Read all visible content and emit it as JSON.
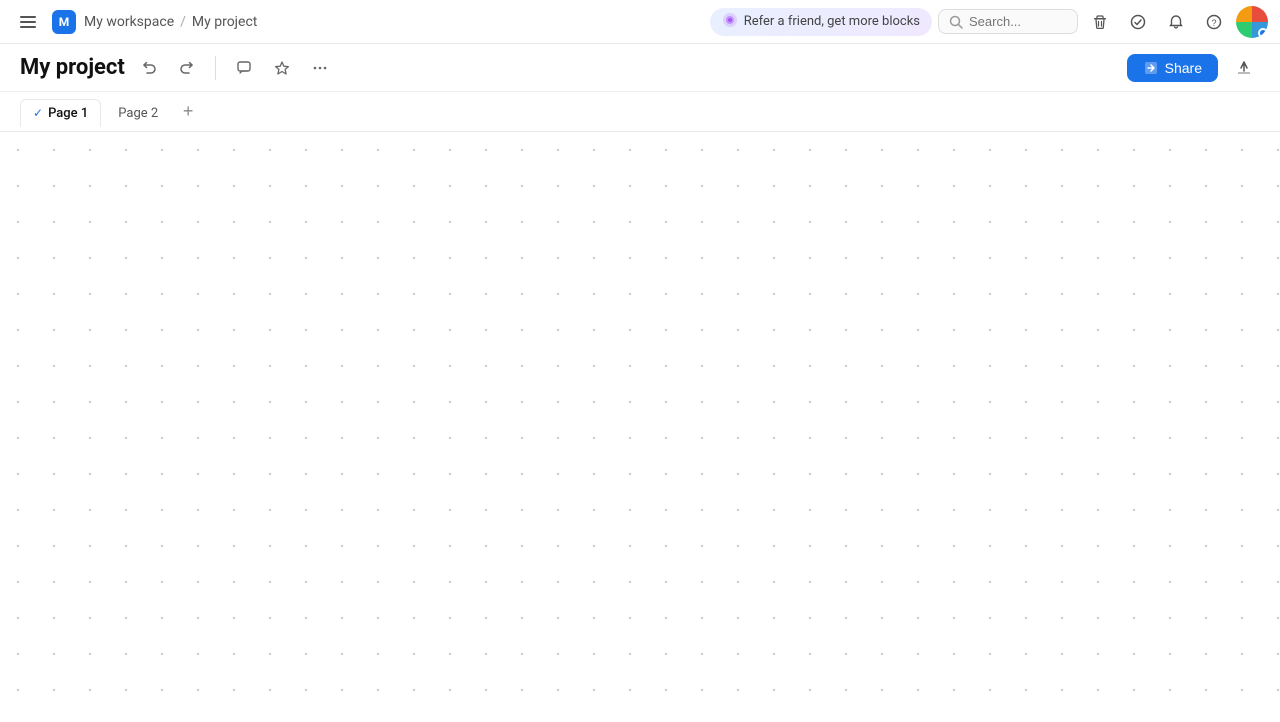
{
  "app": {
    "menu_icon": "☰",
    "workspace": {
      "avatar_letter": "M",
      "name": "My workspace"
    },
    "breadcrumb_sep": "/",
    "project": "My project"
  },
  "topnav": {
    "refer_icon": "🎁",
    "refer_label": "Refer a friend, get more blocks",
    "search_placeholder": "Search...",
    "search_icon": "🔍",
    "trash_icon": "🗑",
    "checkmark_icon": "✓",
    "bell_icon": "🔔",
    "help_icon": "?"
  },
  "toolbar": {
    "title": "My project",
    "undo_icon": "↺",
    "redo_icon": "↻",
    "comment_icon": "💬",
    "star_icon": "☆",
    "more_icon": "•••",
    "share_label": "Share",
    "export_icon": "↑"
  },
  "tabs": [
    {
      "label": "Page 1",
      "active": true,
      "check": true
    },
    {
      "label": "Page 2",
      "active": false,
      "check": false
    }
  ],
  "tabs_add_label": "+"
}
